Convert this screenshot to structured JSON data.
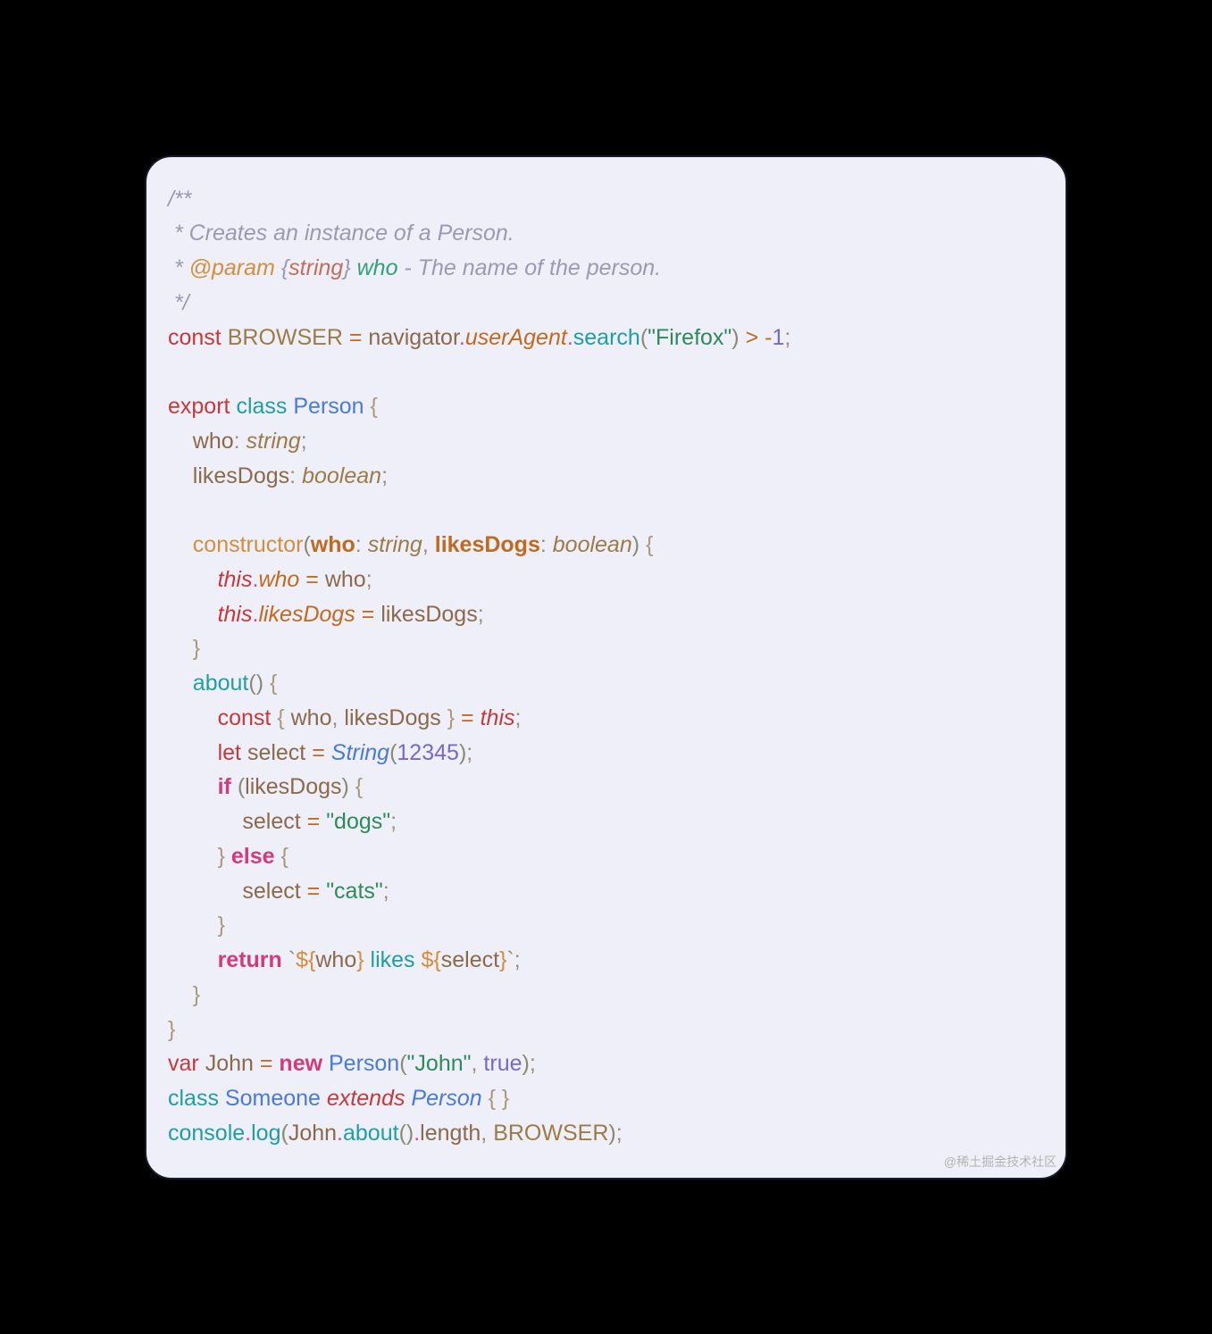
{
  "watermark": "@稀土掘金技术社区",
  "code": {
    "l1": "/**",
    "l2a": " * ",
    "l2b": "Creates an instance of a Person.",
    "l3a": " * ",
    "l3b": "@param",
    "l3c": " {",
    "l3d": "string",
    "l3e": "} ",
    "l3f": "who",
    "l3g": " - The name of the person.",
    "l4": " */",
    "l5a": "const",
    "l5b": " ",
    "l5c": "BROWSER",
    "l5d": " ",
    "l5e": "=",
    "l5f": " ",
    "l5g": "navigator",
    "l5h": ".",
    "l5i": "userAgent",
    "l5j": ".",
    "l5k": "search",
    "l5l": "(",
    "l5m": "\"Firefox\"",
    "l5n": ")",
    "l5o": " ",
    "l5p": ">",
    "l5q": " ",
    "l5r": "-",
    "l5s": "1",
    "l5t": ";",
    "l6": "",
    "l7a": "export",
    "l7b": " ",
    "l7c": "class",
    "l7d": " ",
    "l7e": "Person",
    "l7f": " ",
    "l7g": "{",
    "l8a": "    ",
    "l8b": "who",
    "l8c": ":",
    "l8d": " ",
    "l8e": "string",
    "l8f": ";",
    "l9a": "    ",
    "l9b": "likesDogs",
    "l9c": ":",
    "l9d": " ",
    "l9e": "boolean",
    "l9f": ";",
    "l10": "",
    "l11a": "    ",
    "l11b": "constructor",
    "l11c": "(",
    "l11d": "who",
    "l11e": ":",
    "l11f": " ",
    "l11g": "string",
    "l11h": ",",
    "l11i": " ",
    "l11j": "likesDogs",
    "l11k": ":",
    "l11l": " ",
    "l11m": "boolean",
    "l11n": ")",
    "l11o": " ",
    "l11p": "{",
    "l12a": "        ",
    "l12b": "this",
    "l12c": ".",
    "l12d": "who",
    "l12e": " ",
    "l12f": "=",
    "l12g": " ",
    "l12h": "who",
    "l12i": ";",
    "l13a": "        ",
    "l13b": "this",
    "l13c": ".",
    "l13d": "likesDogs",
    "l13e": " ",
    "l13f": "=",
    "l13g": " ",
    "l13h": "likesDogs",
    "l13i": ";",
    "l14a": "    ",
    "l14b": "}",
    "l15a": "    ",
    "l15b": "about",
    "l15c": "(",
    "l15d": ")",
    "l15e": " ",
    "l15f": "{",
    "l16a": "        ",
    "l16b": "const",
    "l16c": " ",
    "l16d": "{",
    "l16e": " ",
    "l16f": "who",
    "l16g": ",",
    "l16h": " ",
    "l16i": "likesDogs",
    "l16j": " ",
    "l16k": "}",
    "l16l": " ",
    "l16m": "=",
    "l16n": " ",
    "l16o": "this",
    "l16p": ";",
    "l17a": "        ",
    "l17b": "let",
    "l17c": " ",
    "l17d": "select",
    "l17e": " ",
    "l17f": "=",
    "l17g": " ",
    "l17h": "String",
    "l17i": "(",
    "l17j": "12345",
    "l17k": ")",
    "l17l": ";",
    "l18a": "        ",
    "l18b": "if",
    "l18c": " ",
    "l18d": "(",
    "l18e": "likesDogs",
    "l18f": ")",
    "l18g": " ",
    "l18h": "{",
    "l19a": "            ",
    "l19b": "select",
    "l19c": " ",
    "l19d": "=",
    "l19e": " ",
    "l19f": "\"dogs\"",
    "l19g": ";",
    "l20a": "        ",
    "l20b": "}",
    "l20c": " ",
    "l20d": "else",
    "l20e": " ",
    "l20f": "{",
    "l21a": "            ",
    "l21b": "select",
    "l21c": " ",
    "l21d": "=",
    "l21e": " ",
    "l21f": "\"cats\"",
    "l21g": ";",
    "l22a": "        ",
    "l22b": "}",
    "l23a": "        ",
    "l23b": "return",
    "l23c": " ",
    "l23d": "`",
    "l23e": "${",
    "l23f": "who",
    "l23g": "}",
    "l23h": " likes ",
    "l23i": "${",
    "l23j": "select",
    "l23k": "}",
    "l23l": "`",
    "l23m": ";",
    "l24a": "    ",
    "l24b": "}",
    "l25": "}",
    "l26a": "var",
    "l26b": " ",
    "l26c": "John",
    "l26d": " ",
    "l26e": "=",
    "l26f": " ",
    "l26g": "new",
    "l26h": " ",
    "l26i": "Person",
    "l26j": "(",
    "l26k": "\"John\"",
    "l26l": ",",
    "l26m": " ",
    "l26n": "true",
    "l26o": ")",
    "l26p": ";",
    "l27a": "class",
    "l27b": " ",
    "l27c": "Someone",
    "l27d": " ",
    "l27e": "extends",
    "l27f": " ",
    "l27g": "Person",
    "l27h": " ",
    "l27i": "{",
    "l27j": " ",
    "l27k": "}",
    "l28a": "console",
    "l28b": ".",
    "l28c": "log",
    "l28d": "(",
    "l28e": "John",
    "l28f": ".",
    "l28g": "about",
    "l28h": "(",
    "l28i": ")",
    "l28j": ".",
    "l28k": "length",
    "l28l": ",",
    "l28m": " ",
    "l28n": "BROWSER",
    "l28o": ")",
    "l28p": ";"
  }
}
